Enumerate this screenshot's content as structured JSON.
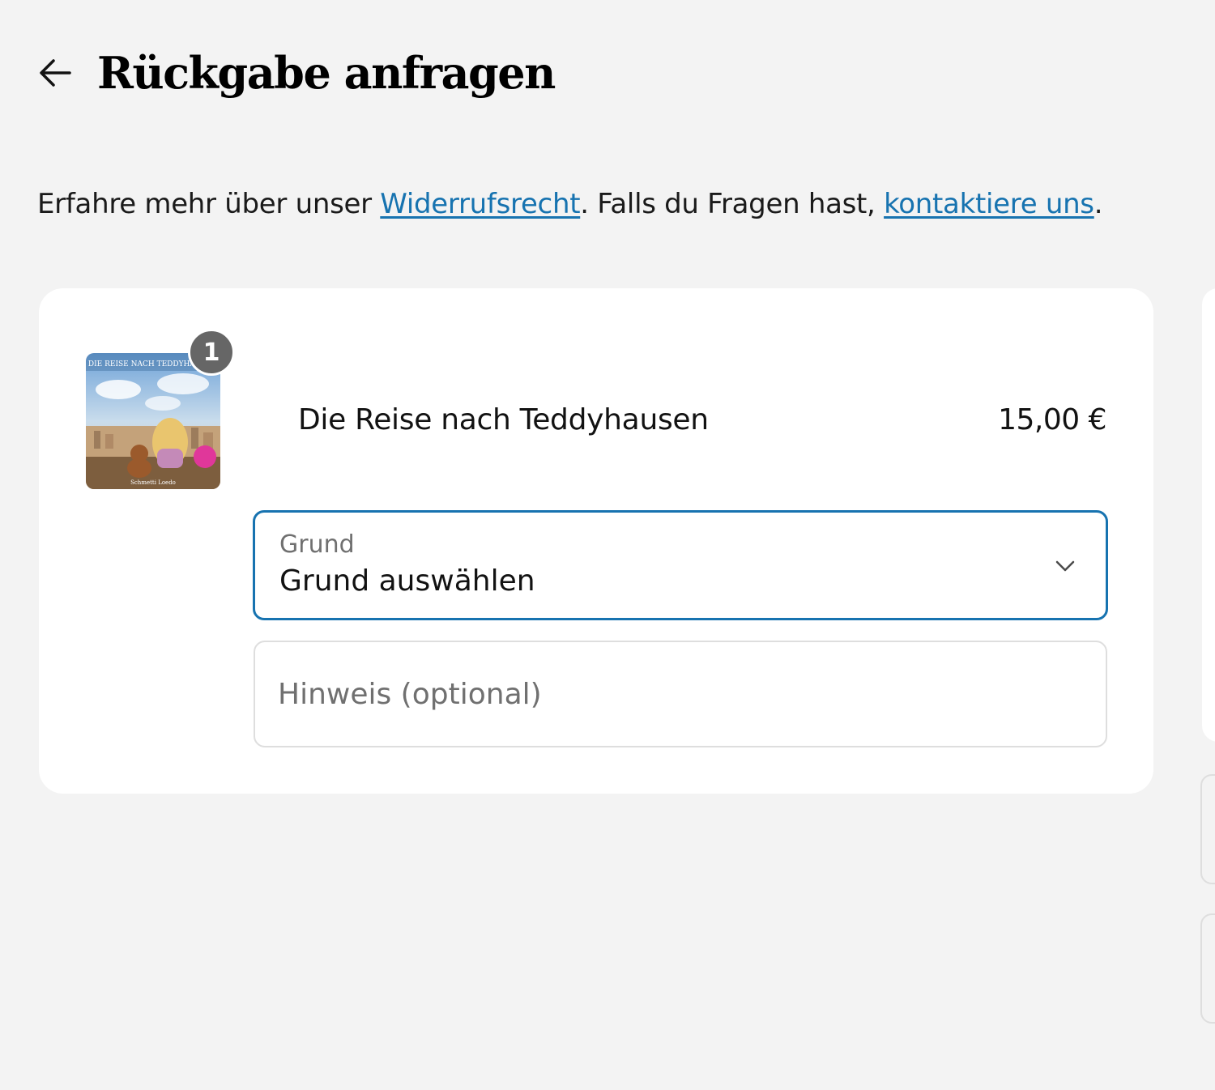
{
  "header": {
    "title": "Rückgabe anfragen",
    "back_icon": "arrow-left-icon"
  },
  "info": {
    "text_before": "Erfahre mehr über unser ",
    "link_policy": "Widerrufsrecht",
    "text_middle": ". Falls du Fragen hast, ",
    "link_contact": "kontaktiere uns",
    "text_after": "."
  },
  "item": {
    "quantity": "1",
    "name": "Die Reise nach Teddyhausen",
    "price": "15,00 €",
    "cover_title": "DIE REISE NACH TEDDYHAUSEN",
    "cover_author": "Schmetti Loedo"
  },
  "reason_select": {
    "label": "Grund",
    "value": "Grund auswählen",
    "icon": "chevron-down-icon"
  },
  "note_field": {
    "placeholder": "Hinweis (optional)",
    "value": ""
  },
  "colors": {
    "accent": "#1773b0",
    "background": "#f3f3f3",
    "card": "#ffffff",
    "badge": "#666666"
  }
}
